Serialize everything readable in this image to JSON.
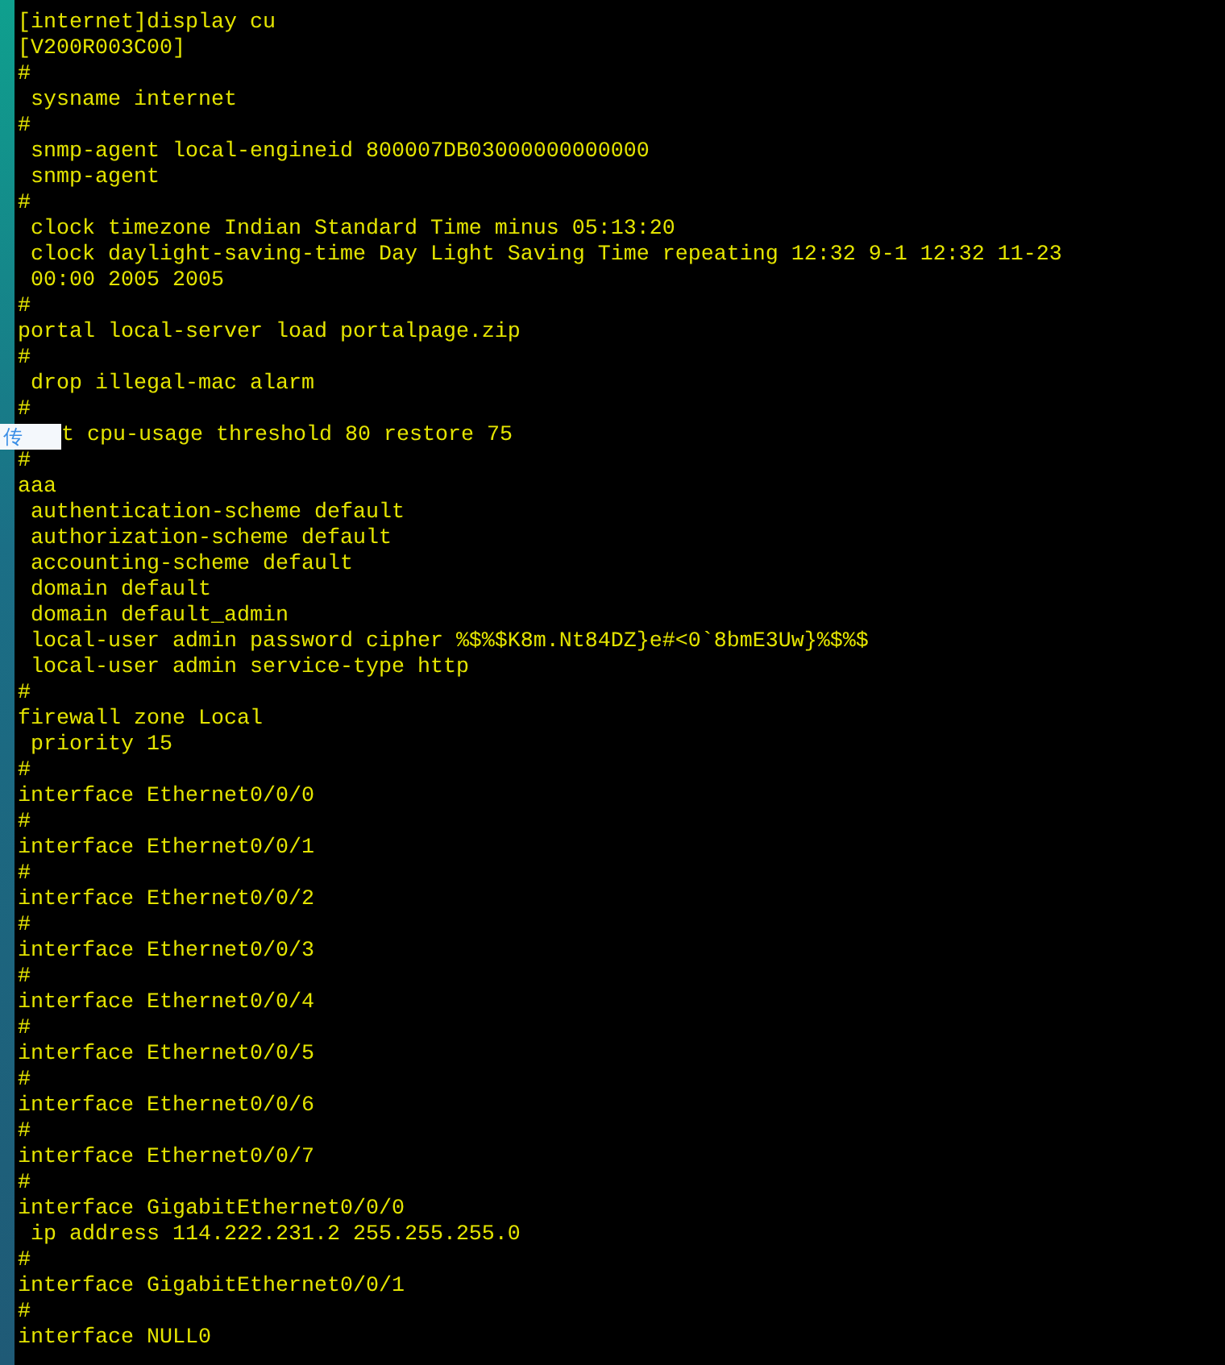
{
  "terminal": {
    "lines_before": [
      "[internet]display cu",
      "[V200R003C00]",
      "#",
      " sysname internet",
      "#",
      " snmp-agent local-engineid 800007DB03000000000000",
      " snmp-agent",
      "#",
      " clock timezone Indian Standard Time minus 05:13:20",
      " clock daylight-saving-time Day Light Saving Time repeating 12:32 9-1 12:32 11-23",
      " 00:00 2005 2005",
      "#",
      "portal local-server load portalpage.zip",
      "#",
      " drop illegal-mac alarm",
      "#"
    ],
    "tooltip_line": {
      "tooltip": "传",
      "text": "t cpu-usage threshold 80 restore 75"
    },
    "lines_after": [
      "#",
      "aaa",
      " authentication-scheme default",
      " authorization-scheme default",
      " accounting-scheme default",
      " domain default",
      " domain default_admin",
      " local-user admin password cipher %$%$K8m.Nt84DZ}e#<0`8bmE3Uw}%$%$",
      " local-user admin service-type http",
      "#",
      "firewall zone Local",
      " priority 15",
      "#",
      "interface Ethernet0/0/0",
      "#",
      "interface Ethernet0/0/1",
      "#",
      "interface Ethernet0/0/2",
      "#",
      "interface Ethernet0/0/3",
      "#",
      "interface Ethernet0/0/4",
      "#",
      "interface Ethernet0/0/5",
      "#",
      "interface Ethernet0/0/6",
      "#",
      "interface Ethernet0/0/7",
      "#",
      "interface GigabitEthernet0/0/0",
      " ip address 114.222.231.2 255.255.255.0",
      "#",
      "interface GigabitEthernet0/0/1",
      "#",
      "interface NULL0"
    ]
  }
}
